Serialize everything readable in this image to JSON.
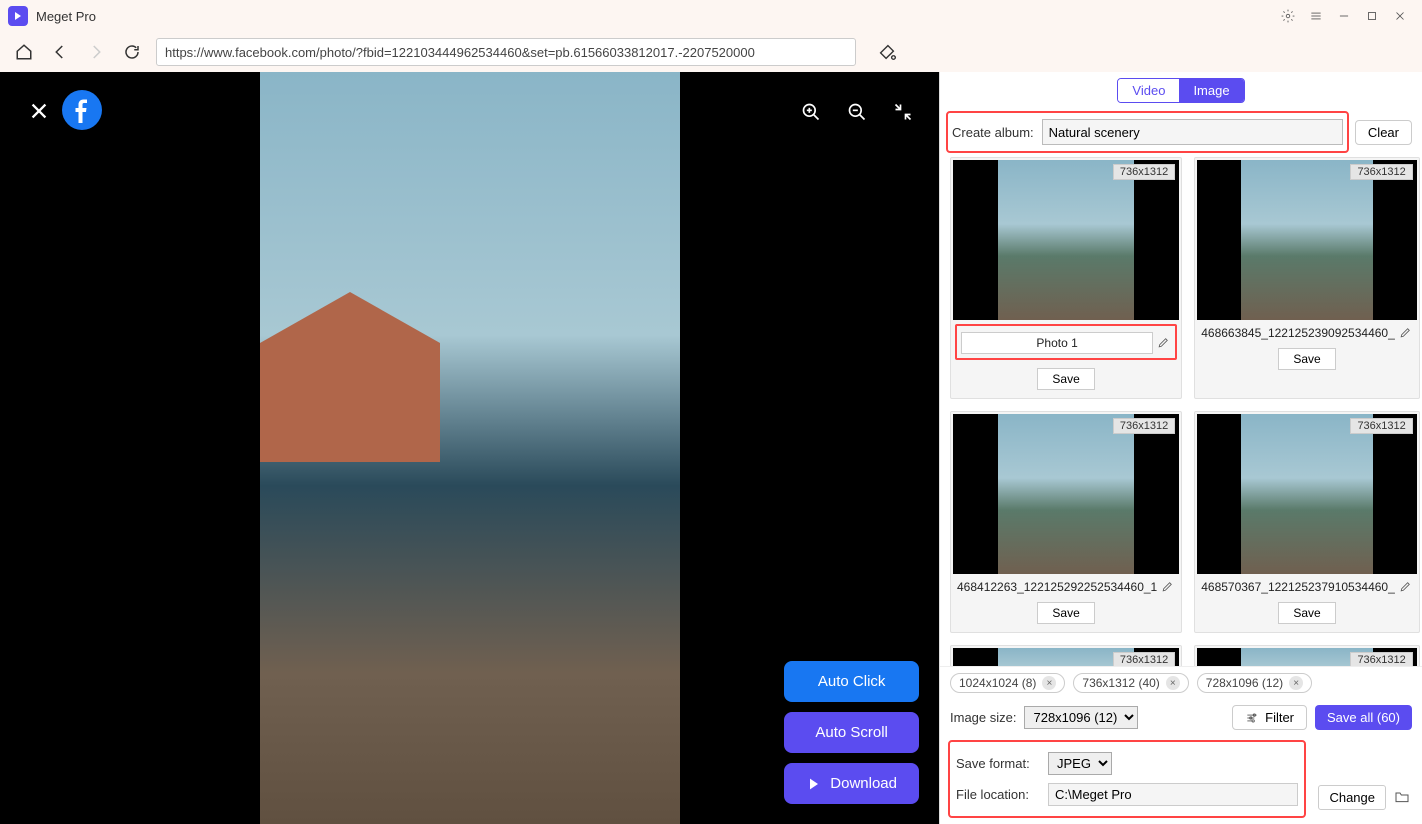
{
  "app": {
    "title": "Meget Pro"
  },
  "url": "https://www.facebook.com/photo/?fbid=122103444962534460&set=pb.61566033812017.-2207520000",
  "viewer": {
    "auto_click": "Auto Click",
    "auto_scroll": "Auto Scroll",
    "download": "Download"
  },
  "panel": {
    "tabs": {
      "video": "Video",
      "image": "Image"
    },
    "create_album_label": "Create album:",
    "album_name": "Natural scenery",
    "clear": "Clear",
    "thumbs": [
      {
        "dim": "736x1312",
        "name": "Photo 1",
        "boxed": true,
        "highlighted": true
      },
      {
        "dim": "736x1312",
        "name": "468663845_122125239092534460_",
        "boxed": false,
        "highlighted": false
      },
      {
        "dim": "736x1312",
        "name": "468412263_122125292252534460_1",
        "boxed": false,
        "highlighted": false
      },
      {
        "dim": "736x1312",
        "name": "468570367_122125237910534460_",
        "boxed": false,
        "highlighted": false
      },
      {
        "dim": "736x1312",
        "name": "",
        "boxed": false,
        "highlighted": false,
        "partial": true
      },
      {
        "dim": "736x1312",
        "name": "",
        "boxed": false,
        "highlighted": false,
        "partial": true
      }
    ],
    "save": "Save",
    "chips": [
      {
        "label": "1024x1024 (8)"
      },
      {
        "label": "736x1312 (40)"
      },
      {
        "label": "728x1096 (12)"
      }
    ],
    "image_size_label": "Image size:",
    "image_size_value": "728x1096 (12)",
    "filter": "Filter",
    "save_all": "Save all (60)",
    "save_format_label": "Save format:",
    "save_format_value": "JPEG",
    "file_location_label": "File location:",
    "file_location_value": "C:\\Meget Pro",
    "change": "Change"
  }
}
